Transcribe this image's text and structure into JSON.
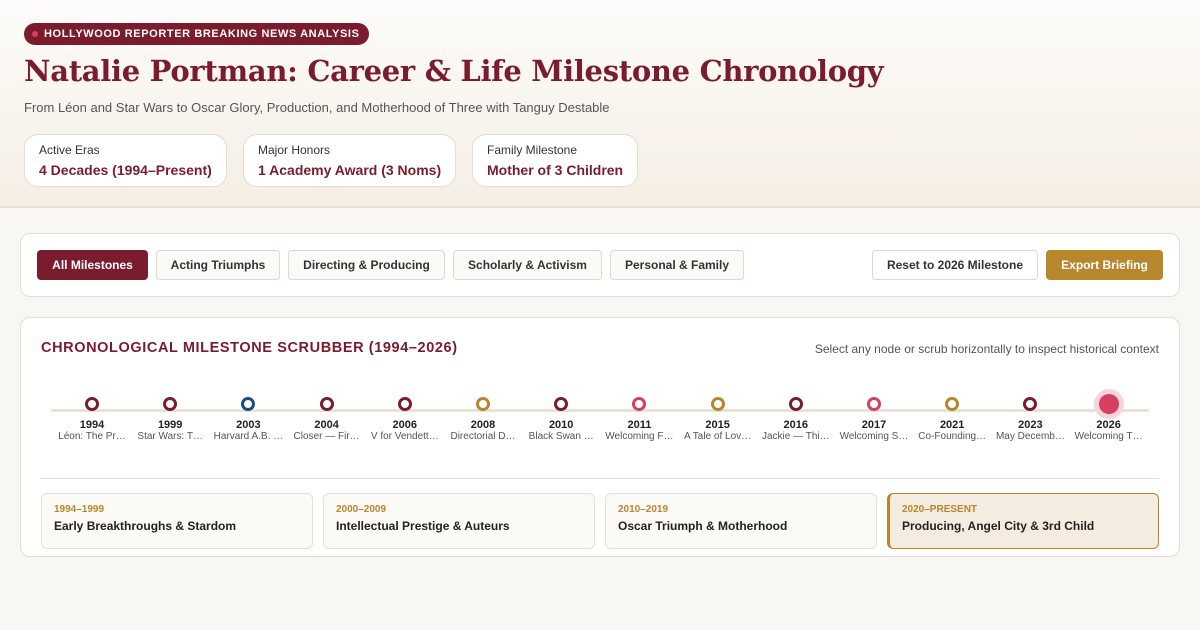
{
  "header": {
    "badge": "HOLLYWOOD REPORTER BREAKING NEWS ANALYSIS",
    "title": "Natalie Portman: Career & Life Milestone Chronology",
    "subtitle": "From Léon and Star Wars to Oscar Glory, Production, and Motherhood of Three with Tanguy Destable"
  },
  "stats": [
    {
      "label": "Active Eras",
      "value": "4 Decades (1994–Present)"
    },
    {
      "label": "Major Honors",
      "value": "1 Academy Award (3 Noms)"
    },
    {
      "label": "Family Milestone",
      "value": "Mother of 3 Children"
    }
  ],
  "filters": {
    "all": "All Milestones",
    "acting": "Acting Triumphs",
    "directing": "Directing & Producing",
    "scholarly": "Scholarly & Activism",
    "personal": "Personal & Family",
    "reset": "Reset to 2026 Milestone",
    "export": "Export Briefing",
    "active": "All Milestones"
  },
  "scrubber": {
    "title": "CHRONOLOGICAL MILESTONE SCRUBBER (1994–2026)",
    "hint": "Select any node or scrub horizontally to inspect historical context",
    "selected_year": "2026",
    "colors": {
      "acting": "#7a1b2e",
      "scholarly": "#1e4a86",
      "directing": "#b8862c",
      "personal": "#d6405f"
    },
    "milestones": [
      {
        "year": "1994",
        "label": "Léon: The Pr…",
        "category": "acting"
      },
      {
        "year": "1999",
        "label": "Star Wars: T…",
        "category": "acting"
      },
      {
        "year": "2003",
        "label": "Harvard A.B. …",
        "category": "scholarly"
      },
      {
        "year": "2004",
        "label": "Closer — Fir…",
        "category": "acting"
      },
      {
        "year": "2006",
        "label": "V for Vendett…",
        "category": "acting"
      },
      {
        "year": "2008",
        "label": "Directorial D…",
        "category": "directing"
      },
      {
        "year": "2010",
        "label": "Black Swan …",
        "category": "acting"
      },
      {
        "year": "2011",
        "label": "Welcoming F…",
        "category": "personal"
      },
      {
        "year": "2015",
        "label": "A Tale of Lov…",
        "category": "directing"
      },
      {
        "year": "2016",
        "label": "Jackie — Thi…",
        "category": "acting"
      },
      {
        "year": "2017",
        "label": "Welcoming S…",
        "category": "personal"
      },
      {
        "year": "2021",
        "label": "Co-Founding…",
        "category": "directing"
      },
      {
        "year": "2023",
        "label": "May Decemb…",
        "category": "acting"
      },
      {
        "year": "2026",
        "label": "Welcoming T…",
        "category": "personal"
      }
    ]
  },
  "eras": [
    {
      "range": "1994–1999",
      "name": "Early Breakthroughs & Stardom"
    },
    {
      "range": "2000–2009",
      "name": "Intellectual Prestige & Auteurs"
    },
    {
      "range": "2010–2019",
      "name": "Oscar Triumph & Motherhood"
    },
    {
      "range": "2020–PRESENT",
      "name": "Producing, Angel City & 3rd Child"
    }
  ],
  "active_era": "2020–PRESENT"
}
